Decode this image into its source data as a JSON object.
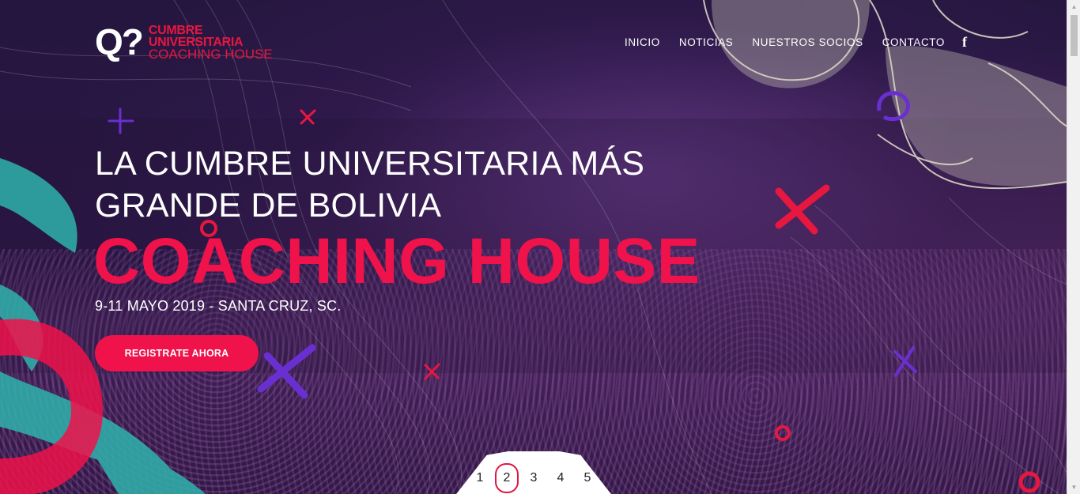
{
  "logo": {
    "mark": "Q?",
    "line1": "CUMBRE",
    "line2": "UNIVERSITARIA",
    "line3": "COACHING HOUSE"
  },
  "nav": {
    "items": [
      {
        "label": "INICIO"
      },
      {
        "label": "NOTICIAS"
      },
      {
        "label": "NUESTROS SOCIOS"
      },
      {
        "label": "CONTACTO"
      }
    ],
    "social_icon": "facebook-icon",
    "social_glyph": "f"
  },
  "hero": {
    "headline": "LA CUMBRE UNIVERSITARIA MÁS GRANDE DE BOLIVIA",
    "brand": "COACHING HOUSE",
    "date": "9-11 MAYO 2019 - SANTA CRUZ, SC.",
    "cta": "REGISTRATE AHORA"
  },
  "pager": {
    "pages": [
      "1",
      "2",
      "3",
      "4",
      "5"
    ],
    "active": "2"
  },
  "colors": {
    "accent": "#f0124a",
    "background": "#24163e",
    "teal": "#2fb3ad",
    "purple": "#6a2fd1",
    "sketch": "#d8d4c4"
  }
}
